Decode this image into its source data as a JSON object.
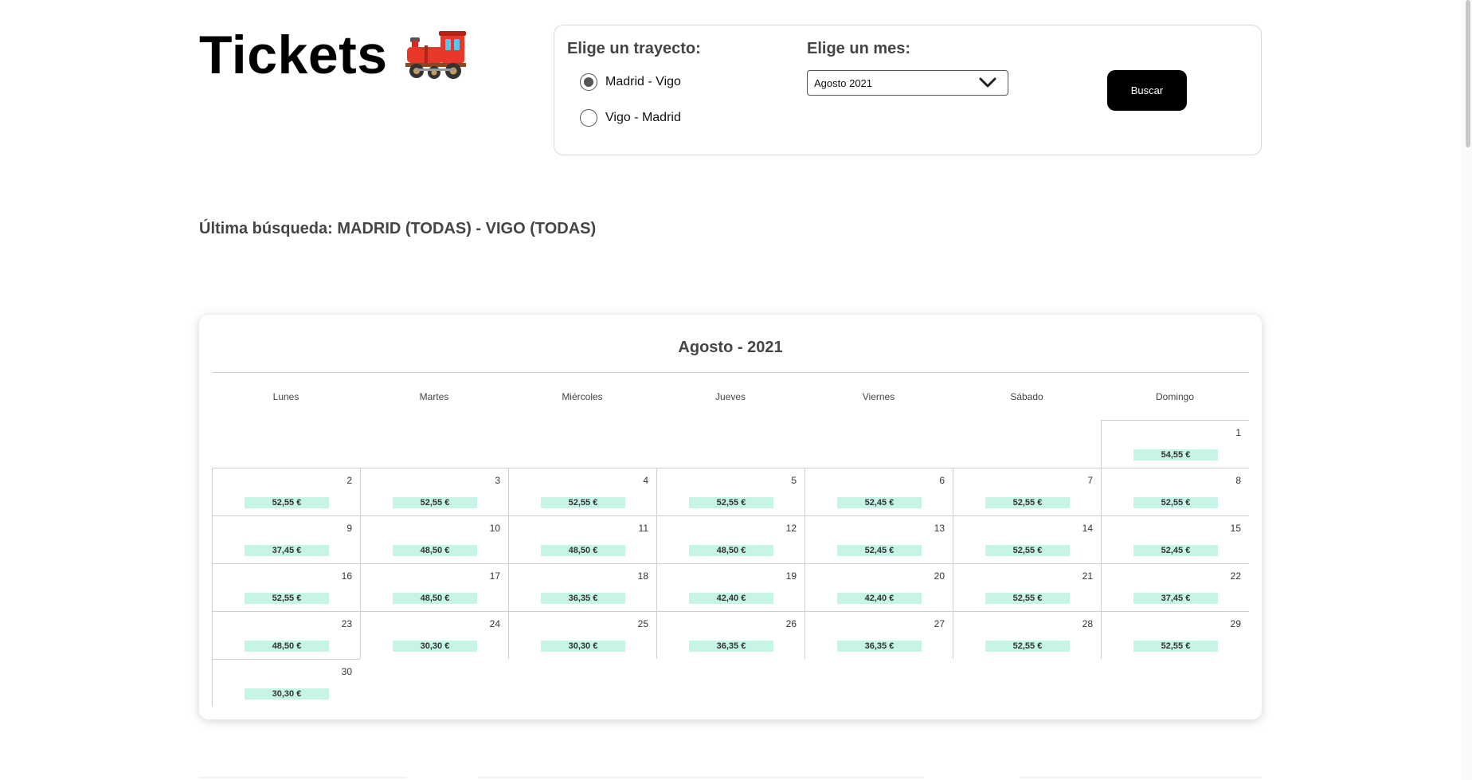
{
  "header": {
    "title": "Tickets",
    "train_icon": "locomotive-icon"
  },
  "search": {
    "route_label": "Elige un trayecto:",
    "routes": [
      {
        "label": "Madrid - Vigo",
        "checked": true
      },
      {
        "label": "Vigo - Madrid",
        "checked": false
      }
    ],
    "month_label": "Elige un mes:",
    "month_selected": "Agosto 2021",
    "button_label": "Buscar"
  },
  "last_search": "Última búsqueda: MADRID (TODAS) - VIGO (TODAS)",
  "calendar": {
    "title": "Agosto - 2021",
    "weekdays": [
      "Lunes",
      "Martes",
      "Miércoles",
      "Jueves",
      "Viernes",
      "Sábado",
      "Domingo"
    ],
    "start_weekday_index": 6,
    "price_color": "#c6f5e4",
    "days": [
      {
        "day": "1",
        "price": "54,55 €"
      },
      {
        "day": "2",
        "price": "52,55 €"
      },
      {
        "day": "3",
        "price": "52,55 €"
      },
      {
        "day": "4",
        "price": "52,55 €"
      },
      {
        "day": "5",
        "price": "52,55 €"
      },
      {
        "day": "6",
        "price": "52,45 €"
      },
      {
        "day": "7",
        "price": "52,55 €"
      },
      {
        "day": "8",
        "price": "52,55 €"
      },
      {
        "day": "9",
        "price": "37,45 €"
      },
      {
        "day": "10",
        "price": "48,50 €"
      },
      {
        "day": "11",
        "price": "48,50 €"
      },
      {
        "day": "12",
        "price": "48,50 €"
      },
      {
        "day": "13",
        "price": "52,45 €"
      },
      {
        "day": "14",
        "price": "52,55 €"
      },
      {
        "day": "15",
        "price": "52,45 €"
      },
      {
        "day": "16",
        "price": "52,55 €"
      },
      {
        "day": "17",
        "price": "48,50 €"
      },
      {
        "day": "18",
        "price": "36,35 €"
      },
      {
        "day": "19",
        "price": "42,40 €"
      },
      {
        "day": "20",
        "price": "42,40 €"
      },
      {
        "day": "21",
        "price": "52,55 €"
      },
      {
        "day": "22",
        "price": "37,45 €"
      },
      {
        "day": "23",
        "price": "48,50 €"
      },
      {
        "day": "24",
        "price": "30,30 €"
      },
      {
        "day": "25",
        "price": "30,30 €"
      },
      {
        "day": "26",
        "price": "36,35 €"
      },
      {
        "day": "27",
        "price": "36,35 €"
      },
      {
        "day": "28",
        "price": "52,55 €"
      },
      {
        "day": "29",
        "price": "52,55 €"
      },
      {
        "day": "30",
        "price": "30,30 €"
      }
    ]
  }
}
